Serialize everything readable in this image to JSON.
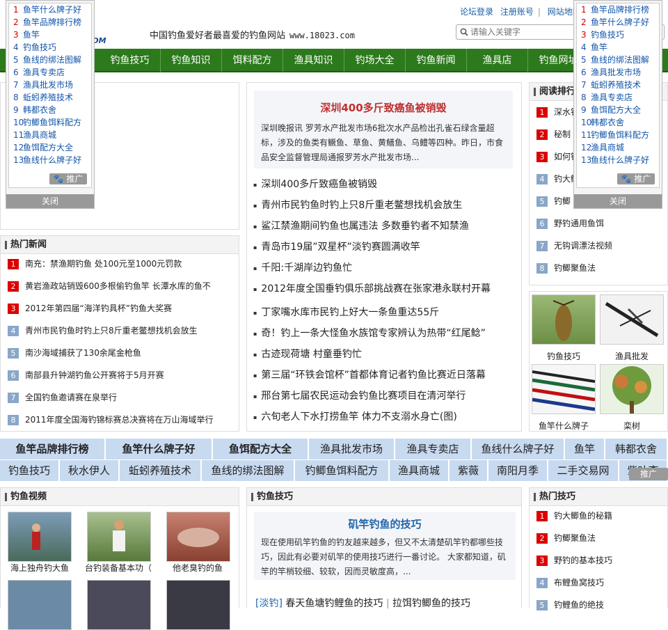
{
  "header": {
    "slogan": "中国钓鱼爱好者最喜爱的钓鱼网站",
    "url": "www.18023.com",
    "toplinks": [
      "论坛登录",
      "注册账号",
      "网站地图"
    ],
    "search_placeholder": "请输入关键字"
  },
  "nav": [
    "钓鱼技巧",
    "钓鱼知识",
    "饵料配方",
    "渔具知识",
    "钓场大全",
    "钓鱼新闻",
    "渔具店",
    "钓鱼网址"
  ],
  "popup_left": {
    "items": [
      "鱼竿什么牌子好",
      "鱼竿品牌排行榜",
      "鱼竿",
      "钓鱼技巧",
      "鱼线的绑法图解",
      "渔具专卖店",
      "渔具批发市场",
      "蚯蚓养殖技术",
      "韩都衣舍",
      "钓鲫鱼饵料配方",
      "渔具商城",
      "鱼饵配方大全",
      "鱼线什么牌子好"
    ],
    "promo": "推广",
    "close": "关闭"
  },
  "popup_right": {
    "items": [
      "鱼竿品牌排行榜",
      "鱼竿什么牌子好",
      "钓鱼技巧",
      "鱼竿",
      "鱼线的绑法图解",
      "渔具批发市场",
      "蚯蚓养殖技术",
      "渔具专卖店",
      "鱼饵配方大全",
      "韩都衣舍",
      "钓鲫鱼饵料配方",
      "渔具商城",
      "鱼线什么牌子好"
    ],
    "promo": "推广",
    "close": "关闭"
  },
  "hot_news": {
    "title": "热门新闻",
    "items": [
      "南充：禁渔期钓鱼 处100元至1000元罚款",
      "黄岩渔政站销毁600多根偷钓鱼竿 长潭水库的鱼不",
      "2012年第四届“海洋钓具杯”钓鱼大奖赛",
      "青州市民钓鱼时钓上只8斤重老鳖想找机会放生",
      "南沙海域捕获了130余尾金枪鱼",
      "南部县升钟湖钓鱼公开赛将于5月开赛",
      "全国钓鱼邀请赛在泉举行",
      "2011年度全国海钓锦标赛总决赛将在万山海域举行"
    ]
  },
  "center": {
    "featured_title": "深圳400多斤致癌鱼被销毁",
    "featured_text": "深圳晚报讯 罗芳水产批发市场6批次水产品检出孔雀石绿含量超标，涉及的鱼类有鳜鱼、草鱼、黄鳝鱼、乌鳢等四种。昨日，市食品安全监督管理局通报罗芳水产批发市场...",
    "news": [
      "深圳400多斤致癌鱼被销毁",
      "青州市民钓鱼时钓上只8斤重老鳖想找机会放生",
      "鲨江禁渔期间钓鱼也属违法 多数垂钓者不知禁渔",
      "青岛市19届”双星杯”淡钓赛圆满收竿",
      "千阳:千湖岸边钓鱼忙",
      "2012年度全国垂钓俱乐部挑战赛在张家港永联村开幕",
      "丁家嘴水库市民钓上好大一条鱼重达55斤",
      "奇！钓上一条大怪鱼水族馆专家辨认为热带“红尾鲶”",
      "古迹现荷塘 村童垂钓忙",
      "第三届“环铁会馆杯”首都体育记者钓鱼比赛近日落幕",
      "邢台第七届农民运动会钓鱼比赛项目在清河举行",
      "六旬老人下水打捞鱼竿 体力不支溺水身亡(图)"
    ]
  },
  "reading_rank": {
    "title": "阅读排行",
    "items": [
      "深水钓",
      "秘制",
      "如何钓",
      "钓大鲫",
      "钓鲫",
      "野钓通用鱼饵",
      "无钩调漂法视频",
      "钓鲫聚鱼法"
    ]
  },
  "image_links": [
    "钓鱼技巧",
    "渔具批发",
    "鱼竿什么牌子",
    "栾树"
  ],
  "tags_row1": [
    "鱼竿品牌排行榜",
    "鱼竿什么牌子好",
    "鱼饵配方大全",
    "渔具批发市场",
    "渔具专卖店",
    "鱼线什么牌子好",
    "鱼竿",
    "韩都衣舍"
  ],
  "tags_row2": [
    "钓鱼技巧",
    "秋水伊人",
    "蚯蚓养殖技术",
    "鱼线的绑法图解",
    "钓鲫鱼饵料配方",
    "渔具商城",
    "紫薇",
    "南阳月季",
    "二手交易网",
    "紫叶李"
  ],
  "tags_promo": "推广",
  "video": {
    "title": "钓鱼视频",
    "items": [
      "海上独舟钓大鱼",
      "台钓装备基本功（",
      "他老臭钓的鱼"
    ]
  },
  "tips": {
    "title": "钓鱼技巧",
    "featured_title": "矶竿钓鱼的技巧",
    "featured_text": "现在使用矶竿钓鱼的钓友越来越多，但又不太清楚矶竿钓都哪些技巧，因此有必要对矶竿的使用技巧进行一番讨论。 大家都知道，矶竿的竿梢较细、较软，因而灵敏度高，...",
    "line_tag": "[淡钓]",
    "line_a": "春天鱼塘钓鲤鱼的技巧",
    "line_b": "拉饵钓鲫鱼的技巧"
  },
  "hot_tips": {
    "title": "热门技巧",
    "items": [
      "钓大鲫鱼的秘籍",
      "钓鲫聚鱼法",
      "野钓的基本技巧",
      "布鲤鱼窝技巧",
      "钓鲤鱼的绝技"
    ]
  }
}
